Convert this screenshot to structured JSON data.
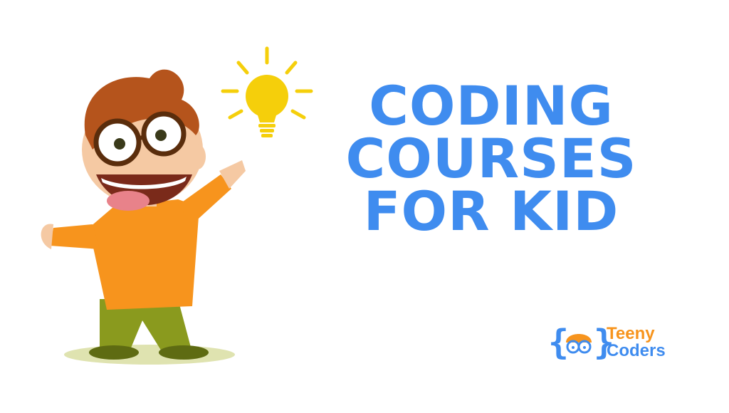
{
  "headline": {
    "line1": "CODING",
    "line2": "COURSES",
    "line3": "FOR KID"
  },
  "logo": {
    "brace_open": "{",
    "brace_close": "}",
    "word1": "Teeny",
    "word2": "Coders"
  },
  "colors": {
    "headline": "#3f8cef",
    "logo_orange": "#f7941d",
    "bulb": "#f5cf0b",
    "shirt": "#f7941d",
    "pants": "#8a9a1e"
  },
  "icons": [
    "lightbulb-icon",
    "coder-face-icon"
  ]
}
